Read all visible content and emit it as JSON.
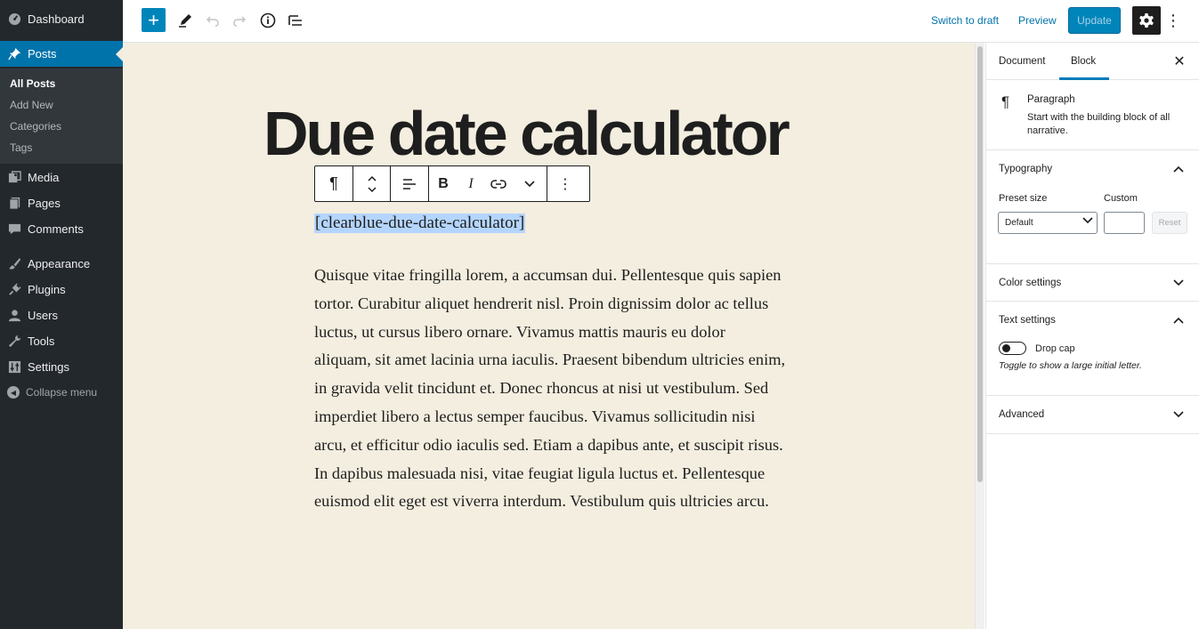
{
  "admin_menu": {
    "dashboard": "Dashboard",
    "posts": "Posts",
    "posts_submenu": [
      "All Posts",
      "Add New",
      "Categories",
      "Tags"
    ],
    "media": "Media",
    "pages": "Pages",
    "comments": "Comments",
    "appearance": "Appearance",
    "plugins": "Plugins",
    "users": "Users",
    "tools": "Tools",
    "settings": "Settings",
    "collapse": "Collapse menu"
  },
  "top_bar": {
    "switch_to_draft": "Switch to draft",
    "preview": "Preview",
    "update": "Update"
  },
  "editor": {
    "title": "Due date calculator",
    "shortcode": "[clearblue-due-date-calculator]",
    "paragraph": "Quisque vitae fringilla lorem, a accumsan dui. Pellentesque quis sapien tortor. Curabitur aliquet hendrerit nisl. Proin dignissim dolor ac tellus luctus, ut cursus libero ornare. Vivamus mattis mauris eu dolor aliquam, sit amet lacinia urna iaculis. Praesent bibendum ultricies enim, in gravida velit tincidunt et. Donec rhoncus at nisi ut vestibulum. Sed imperdiet libero a lectus semper faucibus. Vivamus sollicitudin nisi arcu, et efficitur odio iaculis sed. Etiam a dapibus ante, et suscipit risus. In dapibus malesuada nisi, vitae feugiat ligula luctus et. Pellentesque euismod elit eget est viverra interdum. Vestibulum quis ultricies arcu."
  },
  "settings_panel": {
    "tabs": [
      "Document",
      "Block"
    ],
    "active_tab": "Block",
    "block_card": {
      "title": "Paragraph",
      "description": "Start with the building block of all narrative."
    },
    "typography": {
      "title": "Typography",
      "preset_label": "Preset size",
      "custom_label": "Custom",
      "preset_value": "Default",
      "reset": "Reset"
    },
    "color_settings": "Color settings",
    "text_settings": {
      "title": "Text settings",
      "drop_cap_label": "Drop cap",
      "drop_cap_help": "Toggle to show a large initial letter.",
      "drop_cap_enabled": false
    },
    "advanced": "Advanced"
  },
  "colors": {
    "admin_bg": "#23282d",
    "accent": "#0073aa",
    "canvas_bg": "#f3eedf",
    "selection": "#b4d5fe"
  }
}
